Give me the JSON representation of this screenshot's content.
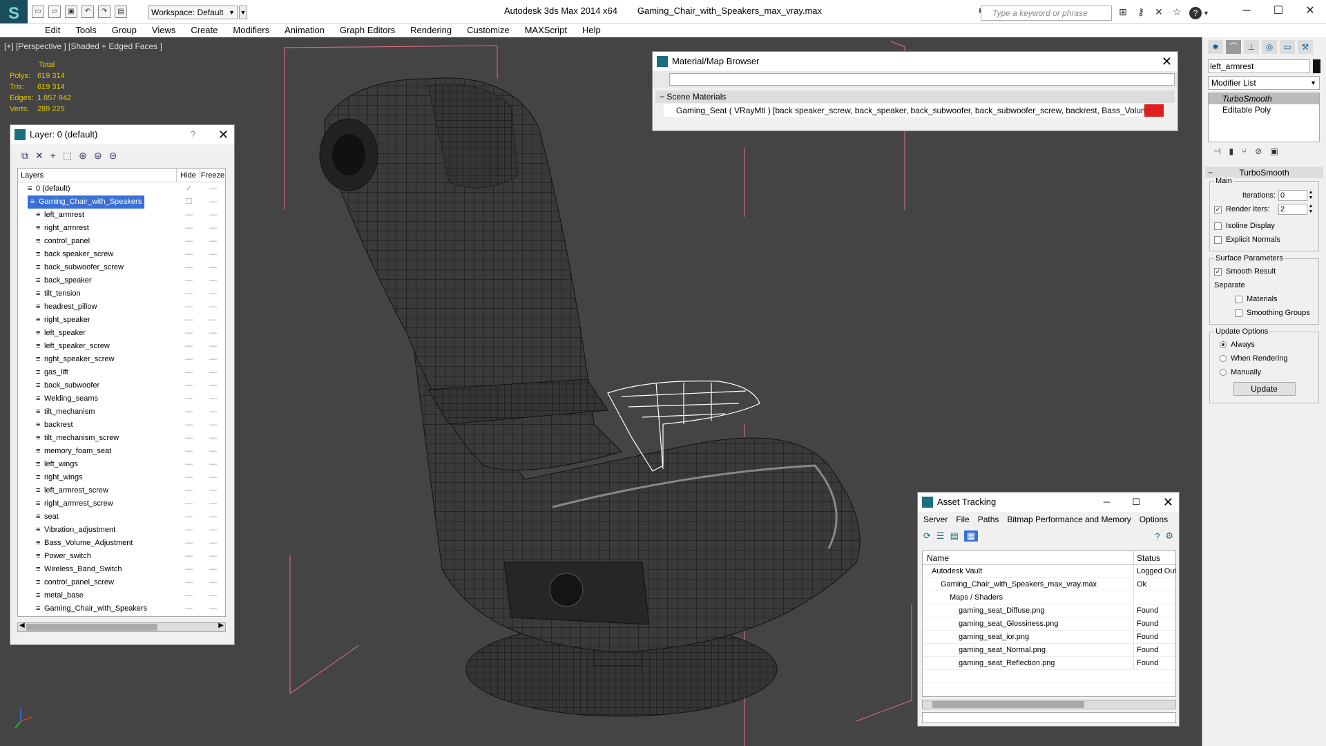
{
  "app": {
    "title": "Autodesk 3ds Max  2014 x64",
    "file": "Gaming_Chair_with_Speakers_max_vray.max",
    "workspace": "Workspace: Default",
    "search_placeholder": "Type a keyword or phrase"
  },
  "menu": [
    "Edit",
    "Tools",
    "Group",
    "Views",
    "Create",
    "Modifiers",
    "Animation",
    "Graph Editors",
    "Rendering",
    "Customize",
    "MAXScript",
    "Help"
  ],
  "viewport": {
    "label": "[+] [Perspective ] [Shaded + Edged Faces ]",
    "stats": {
      "total_label": "Total",
      "rows": [
        {
          "k": "Polys:",
          "v": "619 314"
        },
        {
          "k": "Tris:",
          "v": "619 314"
        },
        {
          "k": "Edges:",
          "v": "1 857 942"
        },
        {
          "k": "Verts:",
          "v": "289 225"
        }
      ]
    }
  },
  "layers": {
    "title": "Layer: 0 (default)",
    "help": "?",
    "col_layers": "Layers",
    "col_hide": "Hide",
    "col_freeze": "Freeze",
    "rows": [
      "0 (default)",
      "Gaming_Chair_with_Speakers",
      "left_armrest",
      "right_armrest",
      "control_panel",
      "back speaker_screw",
      "back_subwoofer_screw",
      "back_speaker",
      "tilt_tension",
      "headrest_pillow",
      "right_speaker",
      "left_speaker",
      "left_speaker_screw",
      "right_speaker_screw",
      "gas_lift",
      "back_subwoofer",
      "Welding_seams",
      "tilt_mechanism",
      "backrest",
      "tilt_mechanism_screw",
      "memory_foam_seat",
      "left_wings",
      "right_wings",
      "left_armrest_screw",
      "right_armrest_screw",
      "seat",
      "Vibration_adjustment",
      "Bass_Volume_Adjustment",
      "Power_switch",
      "Wireless_Band_Switch",
      "control_panel_screw",
      "metal_base",
      "Gaming_Chair_with_Speakers"
    ]
  },
  "material_browser": {
    "title": "Material/Map Browser",
    "section": "Scene Materials",
    "item": "Gaming_Seat ( VRayMtl ) [back speaker_screw, back_speaker, back_subwoofer, back_subwoofer_screw, backrest, Bass_Volume_Adjust..."
  },
  "asset_tracking": {
    "title": "Asset Tracking",
    "menu": [
      "Server",
      "File",
      "Paths",
      "Bitmap Performance and Memory",
      "Options"
    ],
    "col_name": "Name",
    "col_status": "Status",
    "rows": [
      {
        "name": "Autodesk Vault",
        "status": "Logged Out",
        "indent": 1
      },
      {
        "name": "Gaming_Chair_with_Speakers_max_vray.max",
        "status": "Ok",
        "indent": 2
      },
      {
        "name": "Maps / Shaders",
        "status": "",
        "indent": 3
      },
      {
        "name": "gaming_seat_Diffuse.png",
        "status": "Found",
        "indent": 4
      },
      {
        "name": "gaming_seat_Glossiness.png",
        "status": "Found",
        "indent": 4
      },
      {
        "name": "gaming_seat_ior.png",
        "status": "Found",
        "indent": 4
      },
      {
        "name": "gaming_seat_Normal.png",
        "status": "Found",
        "indent": 4
      },
      {
        "name": "gaming_seat_Reflection.png",
        "status": "Found",
        "indent": 4
      }
    ]
  },
  "command_panel": {
    "object_name": "left_armrest",
    "modifier_list": "Modifier List",
    "stack": [
      "TurboSmooth",
      "Editable Poly"
    ],
    "rollout_title": "TurboSmooth",
    "main_label": "Main",
    "iterations_label": "Iterations:",
    "iterations": "0",
    "render_iters_label": "Render Iters:",
    "render_iters": "2",
    "isoline": "Isoline Display",
    "explicit_normals": "Explicit Normals",
    "surface_label": "Surface Parameters",
    "smooth_result": "Smooth Result",
    "separate_label": "Separate",
    "materials": "Materials",
    "smoothing_groups": "Smoothing Groups",
    "update_label": "Update Options",
    "always": "Always",
    "when_rendering": "When Rendering",
    "manually": "Manually",
    "update_button": "Update"
  },
  "colors": {
    "accent": "#3a6fd8",
    "stats": "#e5c600",
    "viewport_bg": "#444444",
    "wire": "#111111",
    "bbox": "#e0708a",
    "selected_wire": "#ffffff"
  }
}
